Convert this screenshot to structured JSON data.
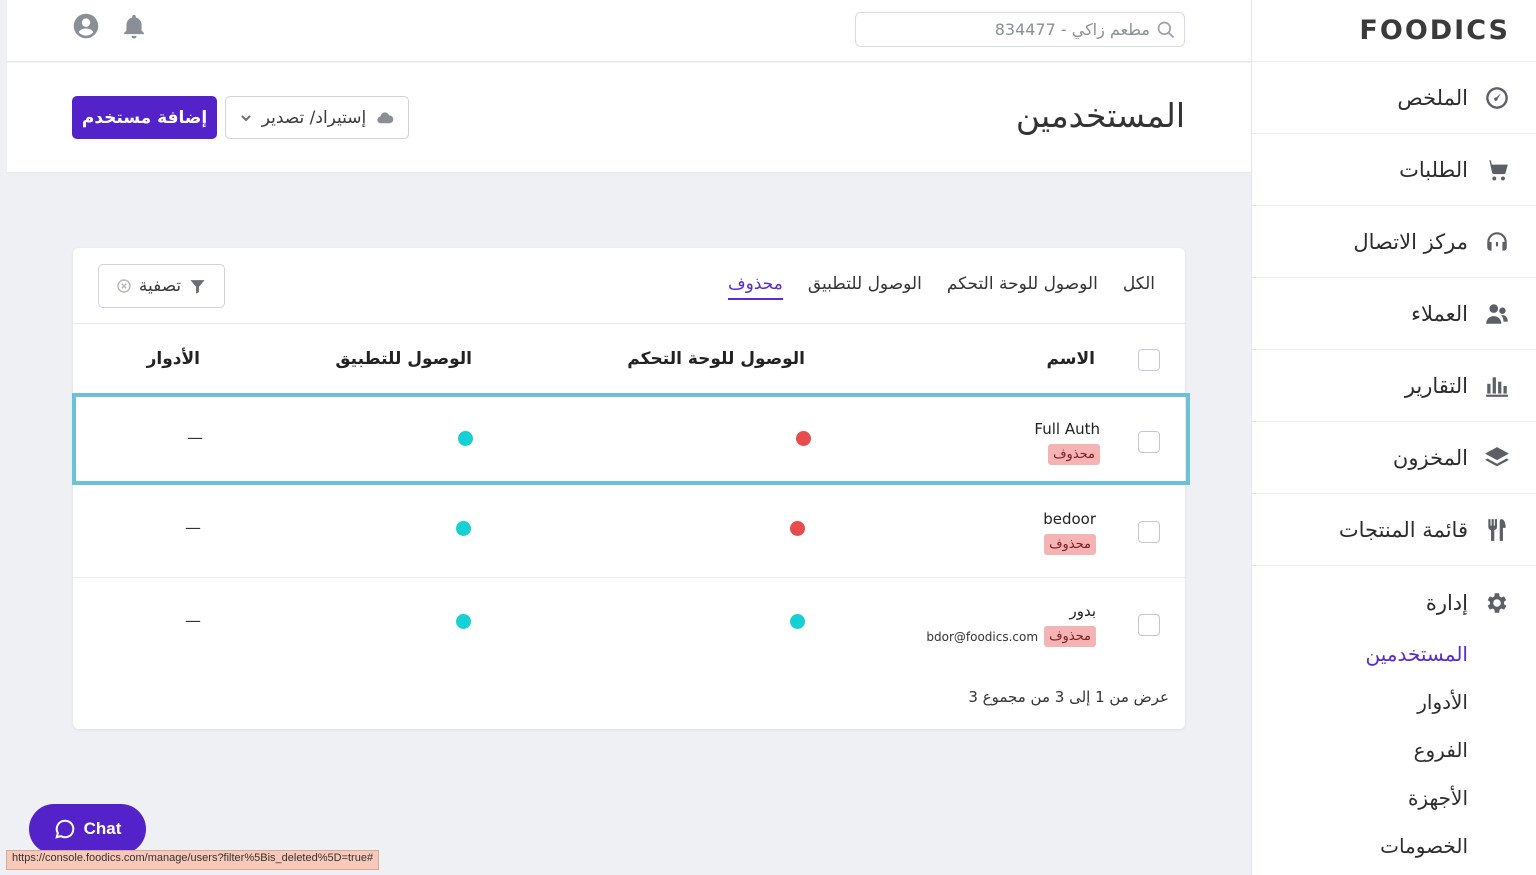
{
  "brand": {
    "logo": "FOODICS"
  },
  "topbar": {
    "search_placeholder": "مطعم زاكي - 834477"
  },
  "sidebar": {
    "items": [
      {
        "label": "الملخص",
        "icon": "dashboard-icon"
      },
      {
        "label": "الطلبات",
        "icon": "cart-icon"
      },
      {
        "label": "مركز الاتصال",
        "icon": "headset-icon"
      },
      {
        "label": "العملاء",
        "icon": "customers-icon"
      },
      {
        "label": "التقارير",
        "icon": "reports-icon"
      },
      {
        "label": "المخزون",
        "icon": "layers-icon"
      },
      {
        "label": "قائمة المنتجات",
        "icon": "utensils-icon"
      }
    ],
    "admin": {
      "label": "إدارة",
      "icon": "gear-icon",
      "subitems": [
        "المستخدمين",
        "الأدوار",
        "الفروع",
        "الأجهزة",
        "الخصومات"
      ],
      "active_index": 0
    }
  },
  "page": {
    "title": "المستخدمين",
    "add_button": "إضافة مستخدم",
    "import_export_button": "إستيراد/ تصدير"
  },
  "tabs": [
    "الكل",
    "الوصول للوحة التحكم",
    "الوصول للتطبيق",
    "محذوف"
  ],
  "active_tab": 3,
  "filter_button": "تصفية",
  "table": {
    "columns": [
      "الاسم",
      "الوصول للوحة التحكم",
      "الوصول للتطبيق",
      "الأدوار"
    ],
    "rows": [
      {
        "name": "Full Auth",
        "badge": "محذوف",
        "email": "",
        "console_access": "red",
        "app_access": "teal",
        "roles": "—"
      },
      {
        "name": "bedoor",
        "badge": "محذوف",
        "email": "",
        "console_access": "red",
        "app_access": "teal",
        "roles": "—"
      },
      {
        "name": "بدور",
        "badge": "محذوف",
        "email": "bdor@foodics.com",
        "console_access": "teal",
        "app_access": "teal",
        "roles": "—"
      }
    ]
  },
  "pagination": {
    "info": "عرض من 1 إلى 3 من مجموع 3"
  },
  "chat": {
    "label": "Chat"
  },
  "status_bar": {
    "url": "https://console.foodics.com/manage/users?filter%5Bis_deleted%5D=true#"
  },
  "colors": {
    "primary": "#5322c8",
    "red_dot": "#e84b4b",
    "teal_dot": "#17d0d4",
    "badge_bg": "#f6b3b3",
    "highlight": "#6cc1d8"
  }
}
